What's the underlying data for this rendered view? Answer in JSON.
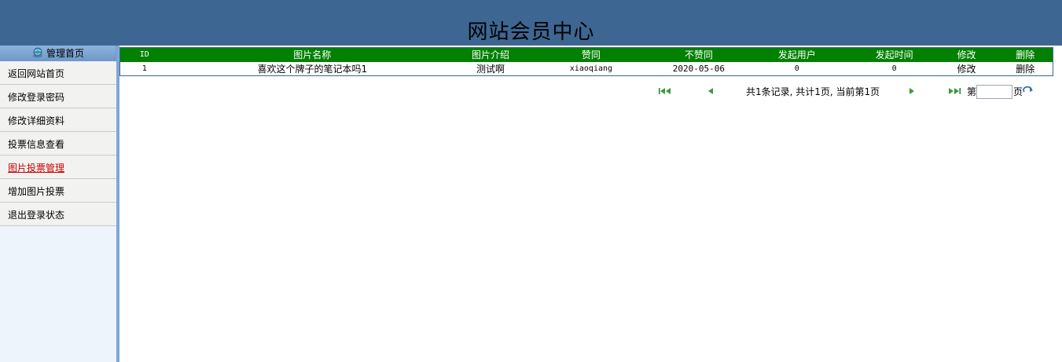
{
  "header": {
    "title": "网站会员中心"
  },
  "sidebar": {
    "head_label": "管理首页",
    "items": [
      {
        "label": "返回网站首页"
      },
      {
        "label": "修改登录密码"
      },
      {
        "label": "修改详细资料"
      },
      {
        "label": "投票信息查看"
      },
      {
        "label": "图片投票管理"
      },
      {
        "label": "增加图片投票"
      },
      {
        "label": "退出登录状态"
      }
    ]
  },
  "table": {
    "headers": [
      "ID",
      "图片名称",
      "图片介绍",
      "赞同",
      "不赞同",
      "发起用户",
      "发起时间",
      "修改",
      "删除"
    ],
    "rows": [
      {
        "id": "1",
        "name": "喜欢这个牌子的笔记本吗1",
        "intro": "测试啊",
        "agree": "xiaoqiang",
        "disagree": "2020-05-06",
        "user": "0",
        "time": "0",
        "edit": "修改",
        "delete": "删除"
      }
    ]
  },
  "pager": {
    "summary": "共1条记录, 共计1页, 当前第1页",
    "page_prefix": "第",
    "page_suffix": "页",
    "page_value": ""
  },
  "colors": {
    "header_bg": "#3d6792",
    "table_header_bg": "#028002",
    "active_menu": "#cc0000",
    "sidebar_bg": "#eef4fc"
  },
  "icons": {
    "first": "first-page-icon",
    "prev": "prev-page-icon",
    "next": "next-page-icon",
    "last": "last-page-icon",
    "go": "go-refresh-icon",
    "home": "home-globe-icon"
  }
}
